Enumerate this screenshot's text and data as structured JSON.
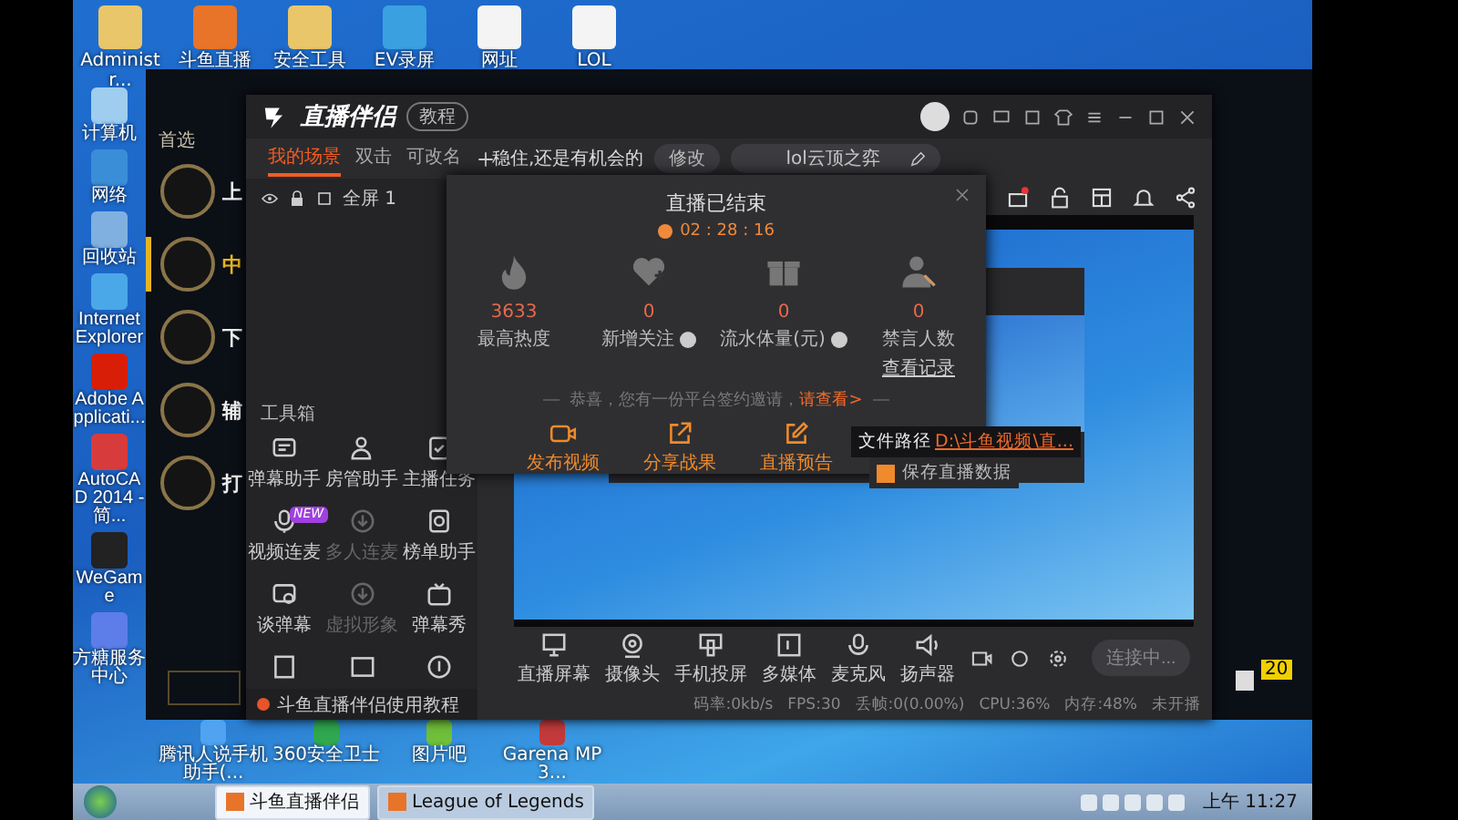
{
  "desktop": {
    "top_icons": [
      {
        "label": "Administr..."
      },
      {
        "label": "斗鱼直播"
      },
      {
        "label": "安全工具"
      },
      {
        "label": "EV录屏"
      },
      {
        "label": "网址"
      },
      {
        "label": "LOL"
      }
    ],
    "left_icons": [
      {
        "label": "计算机"
      },
      {
        "label": "网络"
      },
      {
        "label": "回收站"
      },
      {
        "label": "Internet Explorer"
      },
      {
        "label": "Adobe Applicati..."
      },
      {
        "label": "AutoCAD 2014 - 简..."
      },
      {
        "label": "WeGame"
      },
      {
        "label": "方糖服务中心"
      }
    ],
    "bottom_icons": [
      {
        "label": "腾讯人说手机助手(..."
      },
      {
        "label": "360安全卫士"
      },
      {
        "label": "图片吧"
      },
      {
        "label": "Garena MP3..."
      }
    ],
    "taskbar": {
      "items": [
        {
          "label": "斗鱼直播伴侣",
          "selected": true
        },
        {
          "label": "League of Legends",
          "selected": false
        }
      ],
      "clock": "上午 11:27"
    }
  },
  "game_client": {
    "heading": "首选",
    "roles": [
      {
        "label": "上",
        "selected": false
      },
      {
        "label": "中",
        "selected": true
      },
      {
        "label": "下",
        "selected": false
      },
      {
        "label": "辅",
        "selected": false
      },
      {
        "label": "打",
        "selected": false
      }
    ],
    "side_badge": "20"
  },
  "app": {
    "logo": "直播伴侣",
    "tutorial_button": "教程",
    "scene_tabs": [
      {
        "label": "我的场景",
        "selected": true
      },
      {
        "label": "双击",
        "selected": false
      },
      {
        "label": "可改名",
        "selected": false
      }
    ],
    "stream_title": "稳住,还是有机会的",
    "edit_button": "修改",
    "category": "lol云顶之弈",
    "source": {
      "label": "全屏 1",
      "visible": true,
      "locked": true
    },
    "toolbox_label": "工具箱",
    "tools": [
      {
        "label": "弹幕助手",
        "disabled": false
      },
      {
        "label": "房管助手",
        "disabled": false
      },
      {
        "label": "主播任务",
        "disabled": false
      },
      {
        "label": "视频连麦",
        "disabled": false,
        "badge": "NEW"
      },
      {
        "label": "多人连麦",
        "disabled": true
      },
      {
        "label": "榜单助手",
        "disabled": false
      },
      {
        "label": "谈弹幕",
        "disabled": false
      },
      {
        "label": "虚拟形象",
        "disabled": true
      },
      {
        "label": "弹幕秀",
        "disabled": false
      }
    ],
    "footer_link": "斗鱼直播伴侣使用教程",
    "controls": [
      {
        "label": "直播屏幕"
      },
      {
        "label": "摄像头"
      },
      {
        "label": "手机投屏"
      },
      {
        "label": "多媒体"
      },
      {
        "label": "麦克风"
      },
      {
        "label": "扬声器"
      }
    ],
    "connect_button": "连接中...",
    "status": [
      "码率:0kb/s",
      "FPS:30",
      "丢帧:0(0.00%)",
      "CPU:36%",
      "内存:48%",
      "未开播"
    ],
    "dialog": {
      "title": "直播已结束",
      "duration": "02 : 28 : 16",
      "stats": [
        {
          "value": "3633",
          "label": "最高热度",
          "info": false
        },
        {
          "value": "0",
          "label": "新增关注",
          "info": true
        },
        {
          "value": "0",
          "label": "流水体量(元)",
          "info": true
        },
        {
          "value": "0",
          "label": "禁言人数",
          "info": false,
          "link": "查看记录"
        }
      ],
      "invite_text": "恭喜，您有一份平台签约邀请，",
      "invite_link": "请查看>",
      "actions": [
        {
          "label": "发布视频"
        },
        {
          "label": "分享战果"
        },
        {
          "label": "直播预告"
        }
      ],
      "file_path_label": "文件路径",
      "file_path": "D:\\斗鱼视频\\直...",
      "save_data": {
        "label": "保存直播数据",
        "checked": true
      }
    }
  }
}
